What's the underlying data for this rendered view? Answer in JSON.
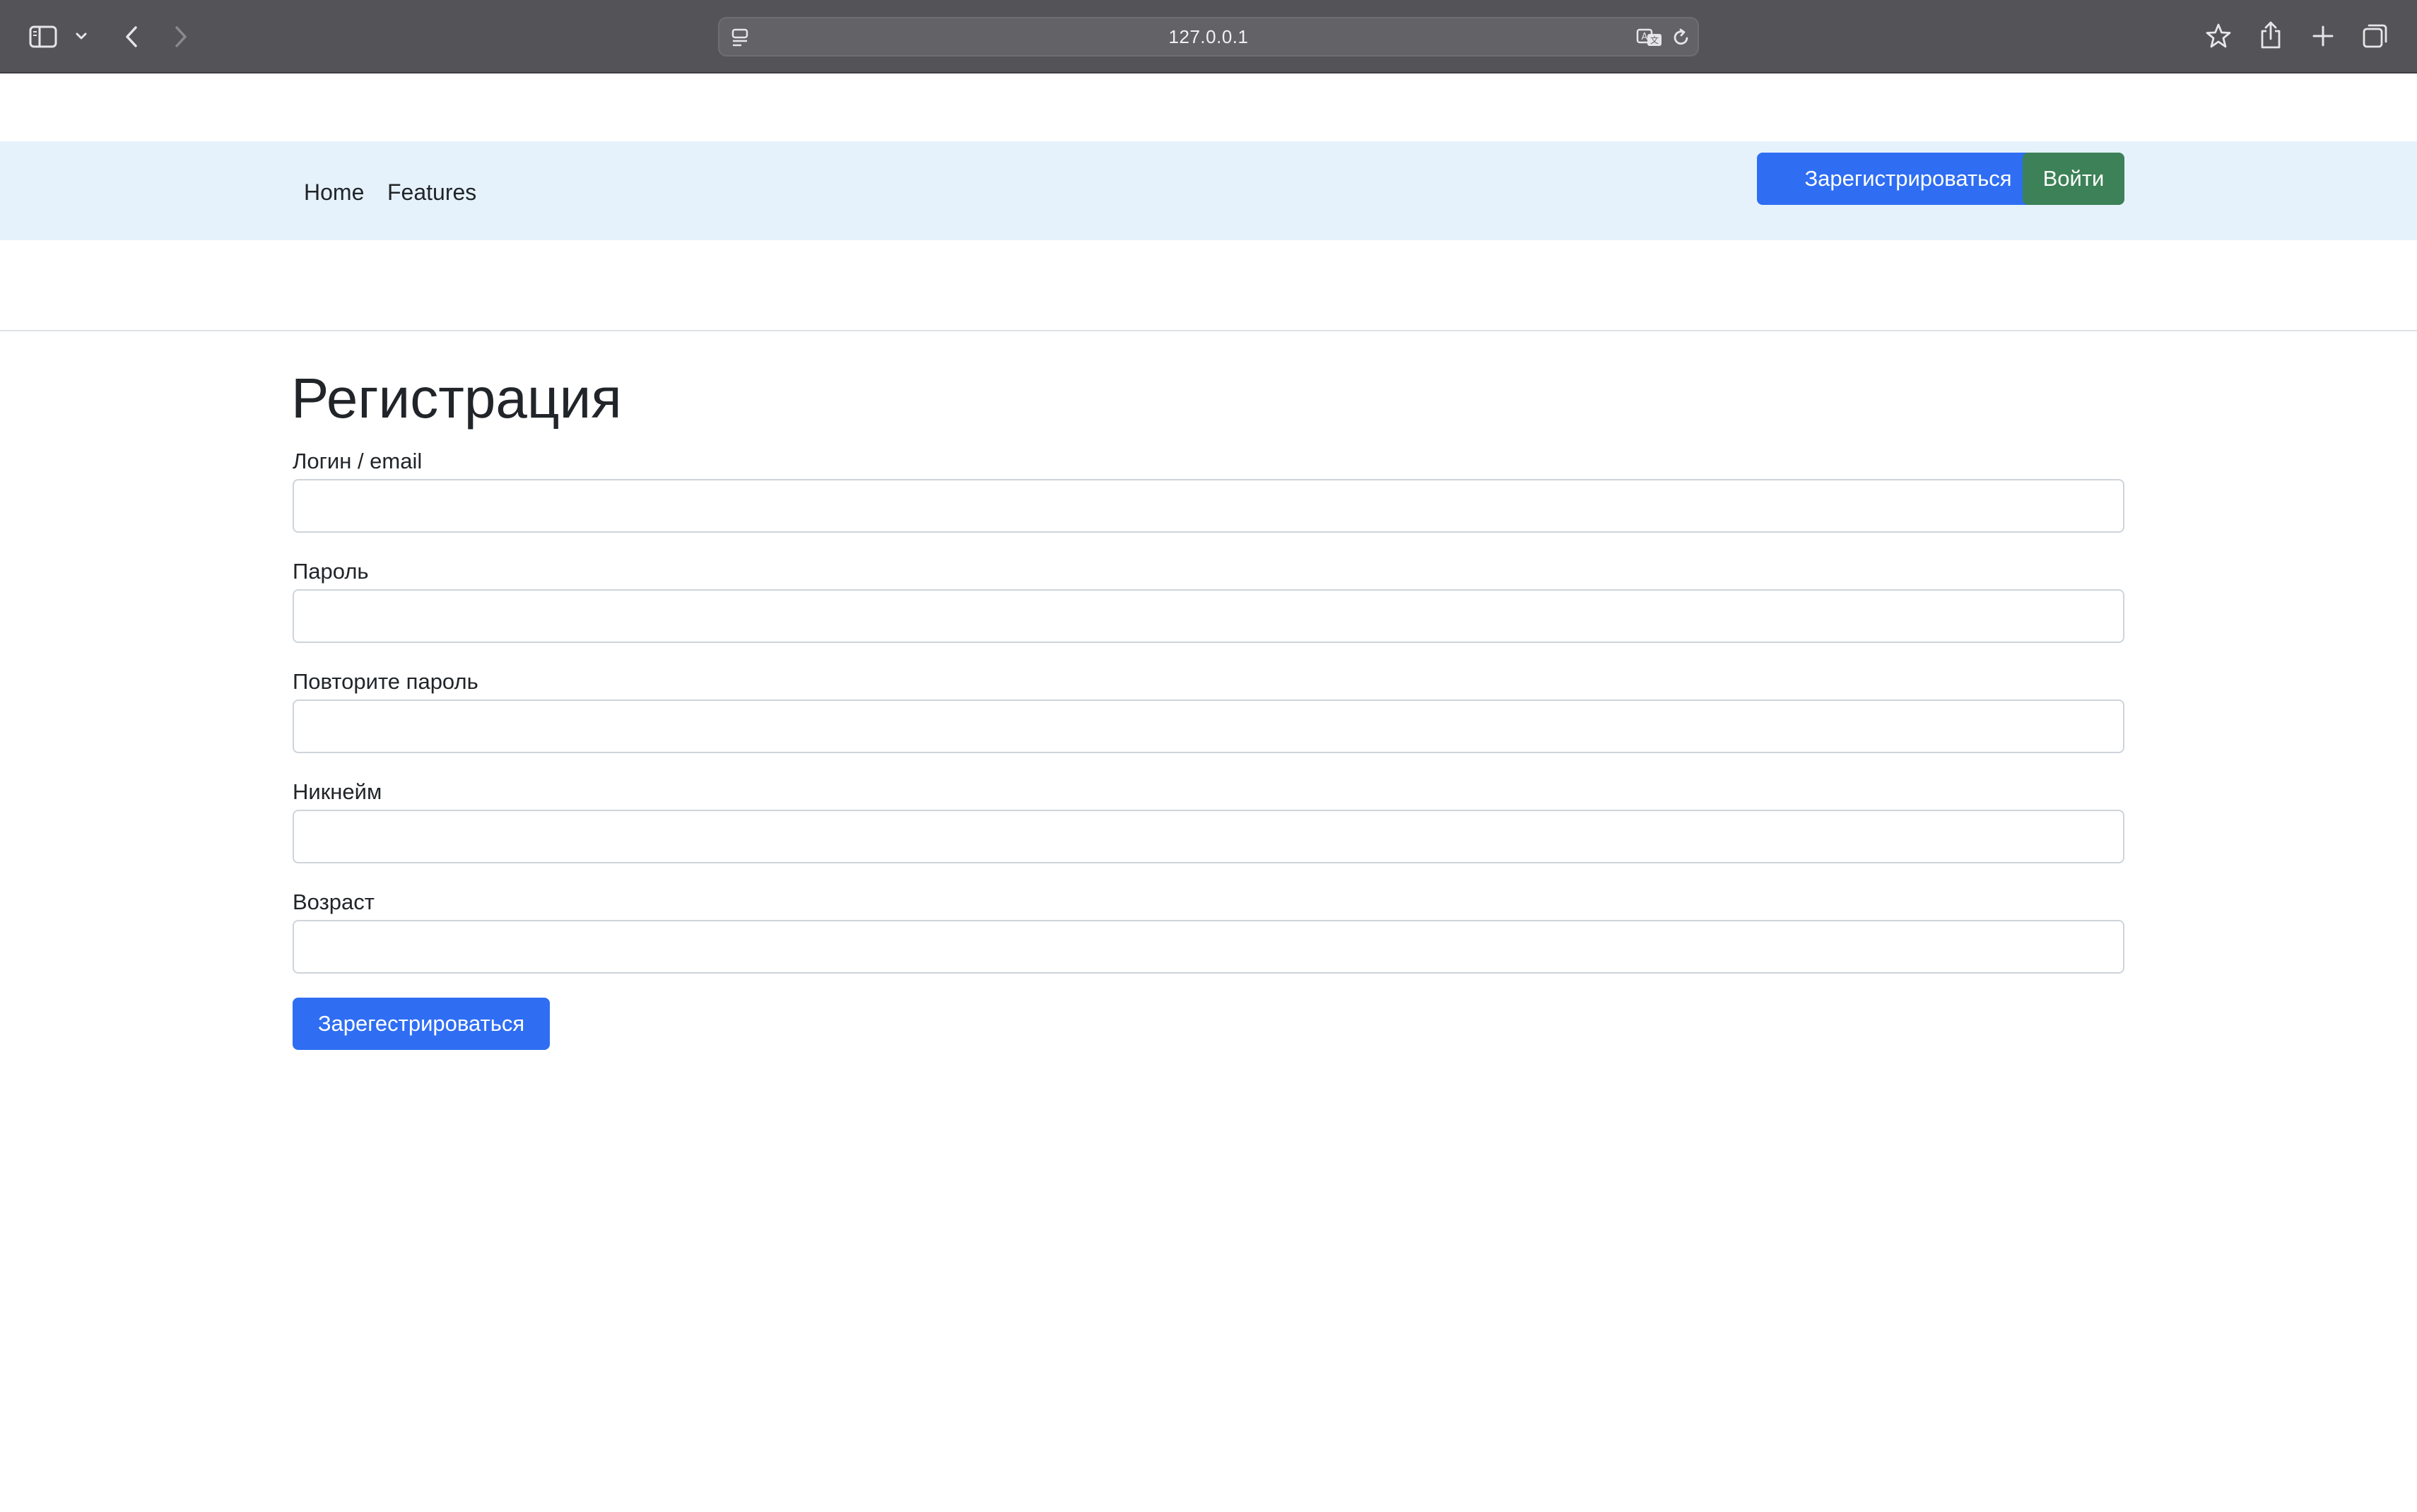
{
  "browser": {
    "url": "127.0.0.1",
    "icons": {
      "sidebar": "sidebar-icon",
      "tab_group_menu": "chevron-down-icon",
      "back": "back-arrow-icon",
      "forward": "forward-arrow-icon",
      "site_info": "page-menu-icon",
      "translate": "translate-icon",
      "reload": "reload-icon",
      "bookmark": "star-icon",
      "share": "share-icon",
      "new_tab": "plus-icon",
      "tab_overview": "tabs-icon"
    }
  },
  "navbar": {
    "links": [
      {
        "label": "Home"
      },
      {
        "label": "Features"
      }
    ],
    "register_label": "Зарегистрироваться",
    "login_label": "Войти"
  },
  "form": {
    "title": "Регистрация",
    "fields": [
      {
        "label": "Логин / email",
        "value": "",
        "placeholder": ""
      },
      {
        "label": "Пароль",
        "value": "",
        "placeholder": ""
      },
      {
        "label": "Повторите пароль",
        "value": "",
        "placeholder": ""
      },
      {
        "label": "Никнейм",
        "value": "",
        "placeholder": ""
      },
      {
        "label": "Возраст",
        "value": "",
        "placeholder": ""
      }
    ],
    "submit_label": "Зарегестрироваться"
  },
  "colors": {
    "chrome_background": "#545357",
    "navbar_background": "#e6f2fb",
    "primary": "#2f6ef3",
    "success": "#3c8157"
  }
}
